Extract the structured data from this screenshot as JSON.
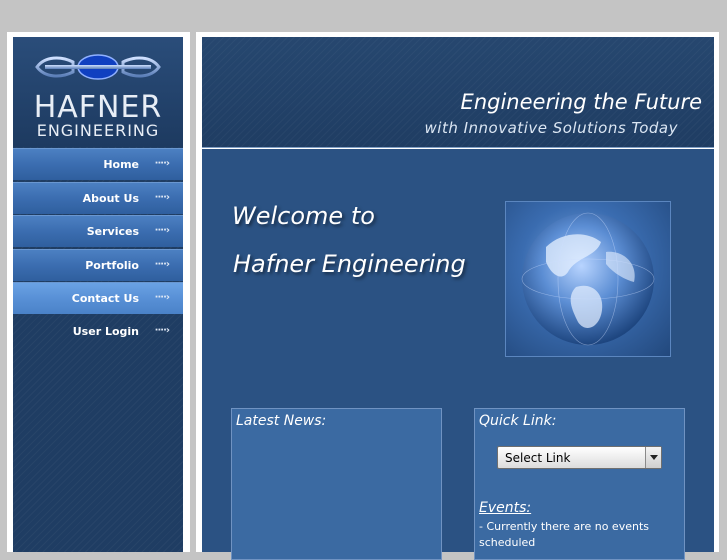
{
  "logo": {
    "name_top": "HAFNER",
    "name_bottom": "ENGINEERING"
  },
  "nav": {
    "items": [
      {
        "label": "Home"
      },
      {
        "label": "About Us"
      },
      {
        "label": "Services"
      },
      {
        "label": "Portfolio"
      },
      {
        "label": "Contact Us"
      },
      {
        "label": "User Login"
      }
    ],
    "arrow": "····›"
  },
  "header": {
    "tagline_main": "Engineering the Future",
    "tagline_sub": "with Innovative Solutions Today"
  },
  "main": {
    "welcome_line1": "Welcome to",
    "welcome_line2": "Hafner Engineering"
  },
  "news": {
    "title": "Latest News:"
  },
  "quicklink": {
    "title": "Quick Link:",
    "select_value": "Select Link",
    "events_title": "Events:",
    "events_text": "- Currently there are no events scheduled"
  },
  "colors": {
    "background": "#c4c4c4",
    "sidebar": "#1f3d63",
    "main": "#2b5283",
    "nav_button": "#3b6db0"
  }
}
